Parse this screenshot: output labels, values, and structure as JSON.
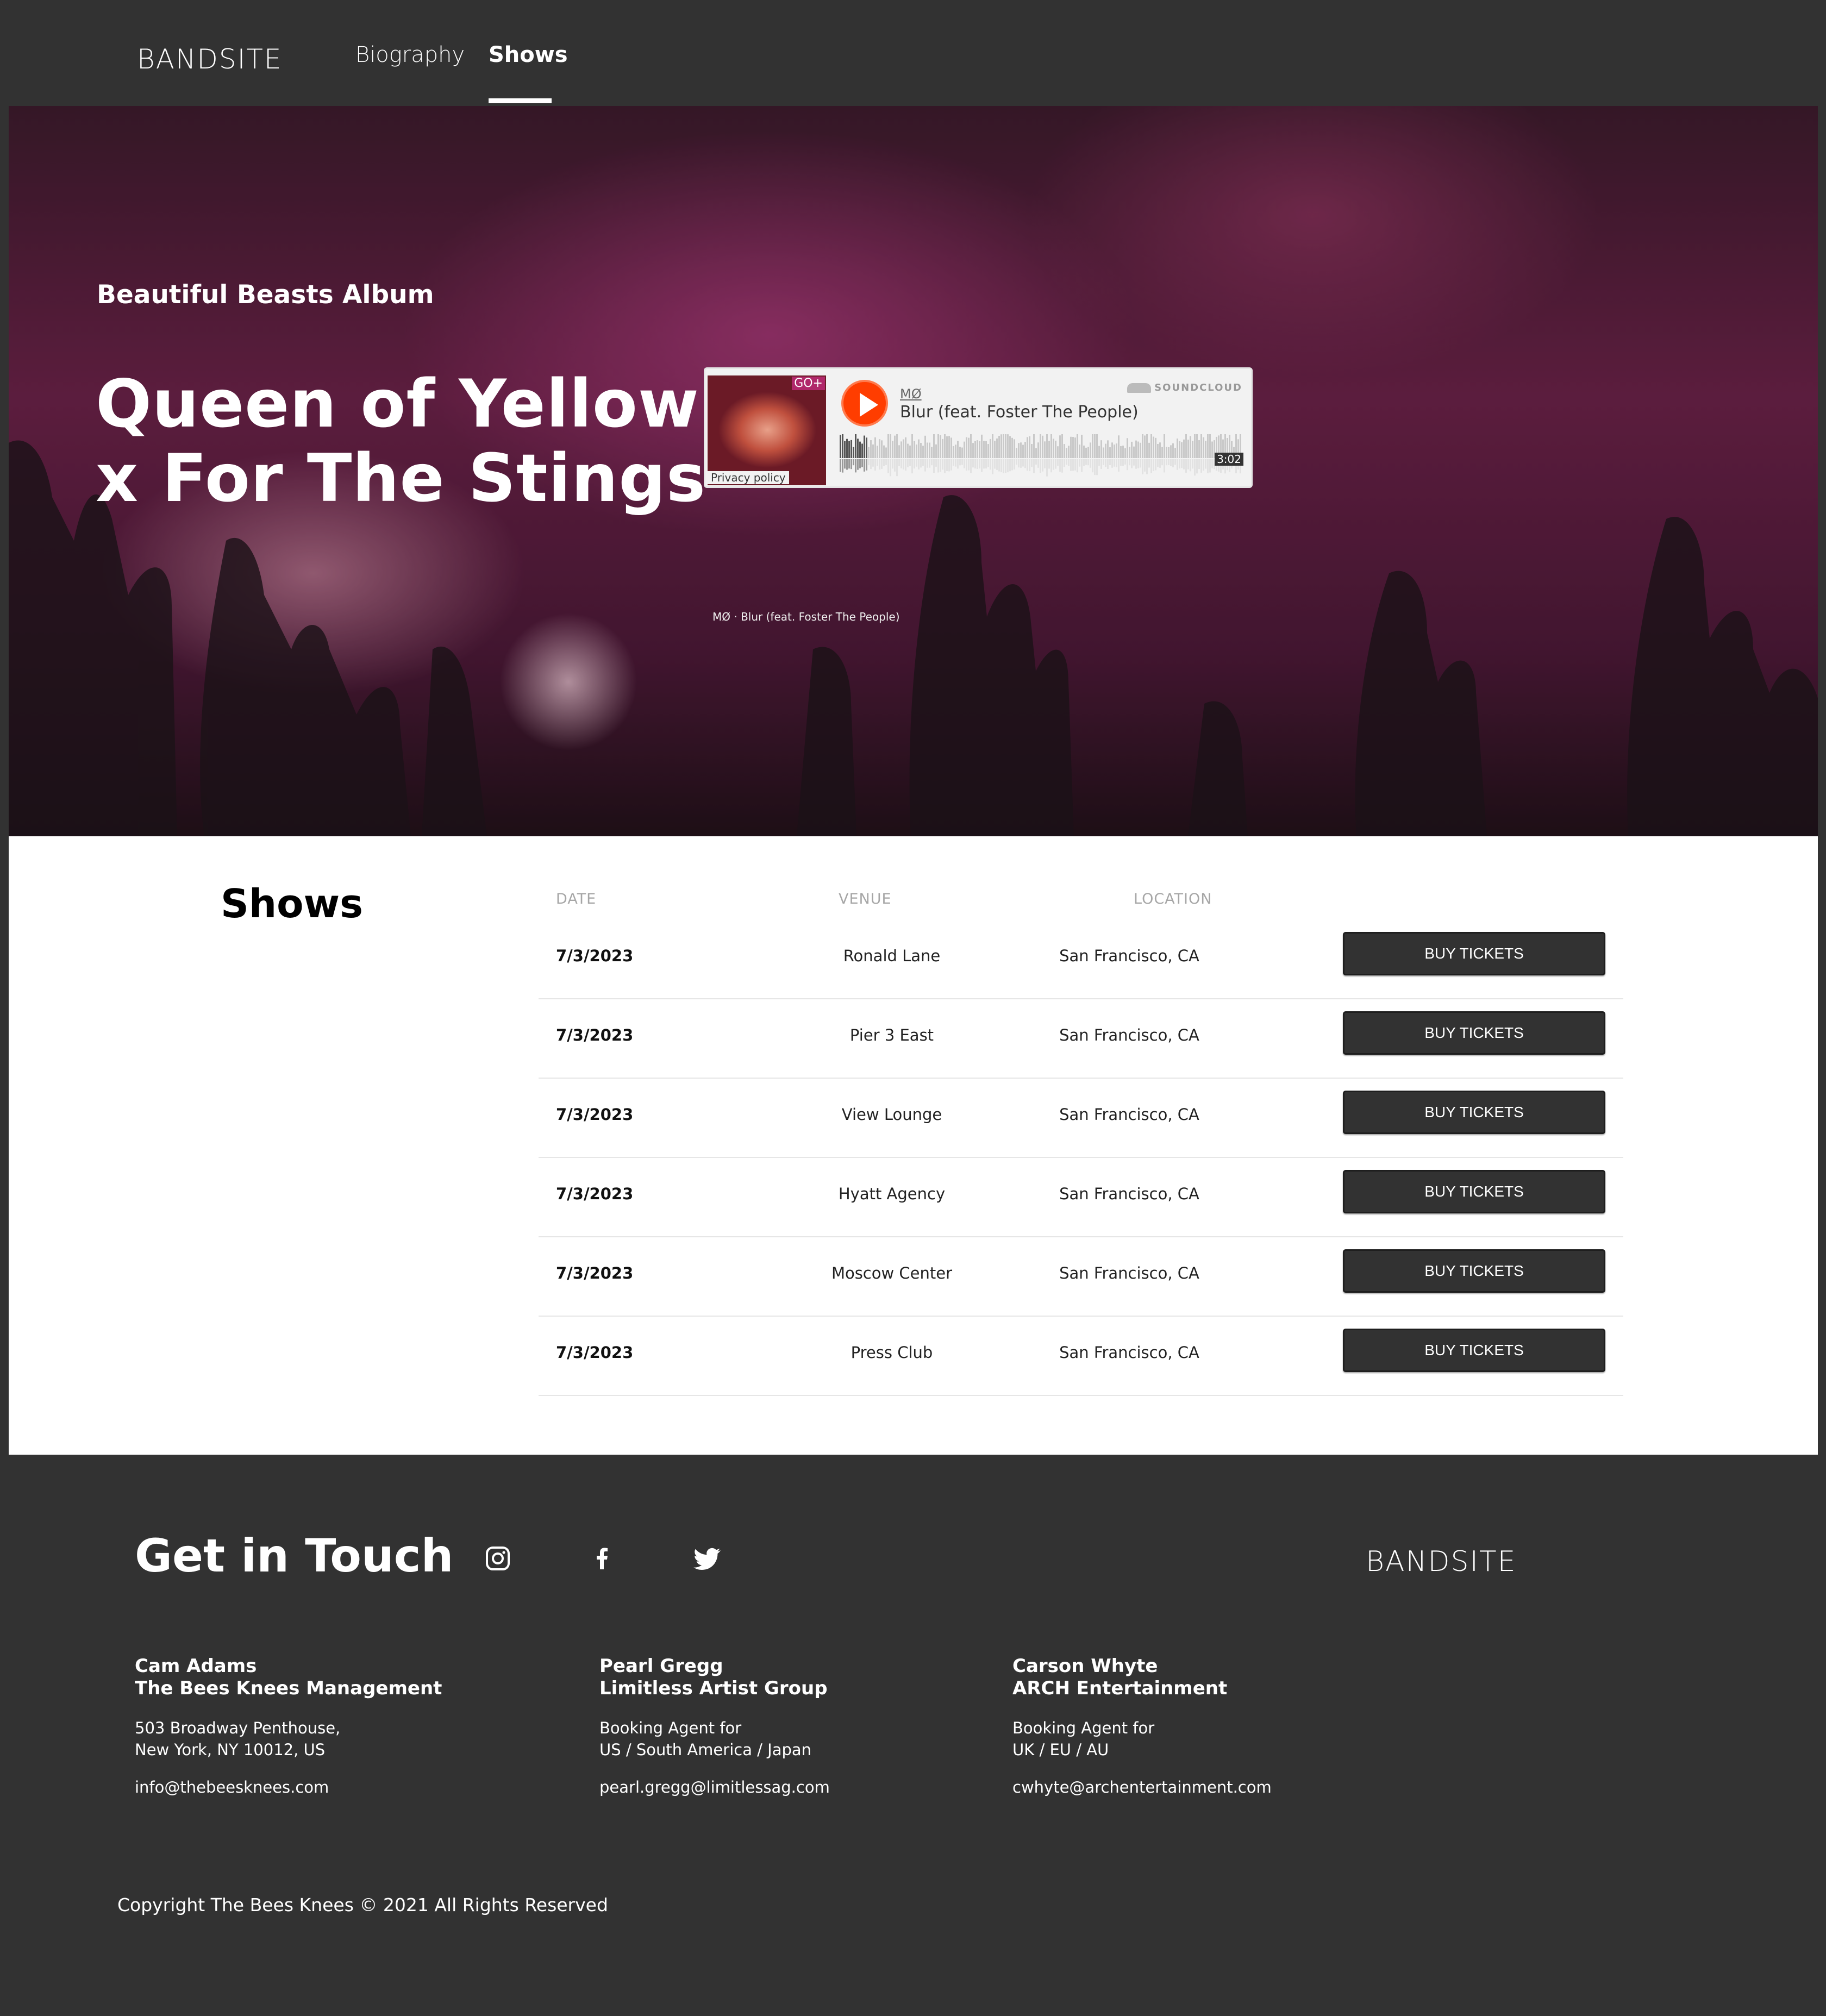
{
  "nav": {
    "logo": "BANDSITE",
    "links": [
      {
        "label": "Biography"
      },
      {
        "label": "Shows"
      }
    ]
  },
  "hero": {
    "album_label": "Beautiful Beasts Album",
    "title": "Queen of Yellow x For The Stings",
    "player": {
      "badge": "GO+",
      "artist": "MØ",
      "track": "Blur (feat. Foster The People)",
      "brand": "SOUNDCLOUD",
      "duration": "3:02",
      "privacy": "Privacy policy",
      "progress": 0.07,
      "play_icon": "play-icon"
    },
    "caption": "MØ · Blur (feat. Foster The People)"
  },
  "shows": {
    "title": "Shows",
    "headers": {
      "date": "DATE",
      "venue": "VENUE",
      "location": "LOCATION"
    },
    "button_label": "BUY TICKETS",
    "rows": [
      {
        "date": "7/3/2023",
        "venue": "Ronald Lane",
        "location": "San Francisco, CA"
      },
      {
        "date": "7/3/2023",
        "venue": "Pier 3 East",
        "location": "San Francisco, CA"
      },
      {
        "date": "7/3/2023",
        "venue": "View Lounge",
        "location": "San Francisco, CA"
      },
      {
        "date": "7/3/2023",
        "venue": "Hyatt Agency",
        "location": "San Francisco, CA"
      },
      {
        "date": "7/3/2023",
        "venue": "Moscow Center",
        "location": "San Francisco, CA"
      },
      {
        "date": "7/3/2023",
        "venue": "Press Club",
        "location": "San Francisco, CA"
      }
    ]
  },
  "footer": {
    "title": "Get in Touch",
    "social_icons": [
      "instagram-icon",
      "facebook-icon",
      "twitter-icon"
    ],
    "logo": "BANDSITE",
    "contacts": [
      {
        "name": "Cam Adams",
        "company": "The Bees Knees Management",
        "line1": "503 Broadway Penthouse,",
        "line2": "New York, NY 10012, US",
        "email": "info@thebeesknees.com"
      },
      {
        "name": "Pearl Gregg",
        "company": "Limitless Artist Group",
        "line1": "Booking Agent for",
        "line2": "US / South America / Japan",
        "email": "pearl.gregg@limitlessag.com"
      },
      {
        "name": "Carson Whyte",
        "company": "ARCH Entertainment",
        "line1": "Booking Agent for",
        "line2": "UK / EU / AU",
        "email": "cwhyte@archentertainment.com"
      }
    ],
    "copyright": "Copyright The Bees Knees © 2021 All Rights Reserved"
  },
  "colors": {
    "background": "#323232",
    "accent_play": "#ff3d00",
    "white": "#ffffff"
  }
}
